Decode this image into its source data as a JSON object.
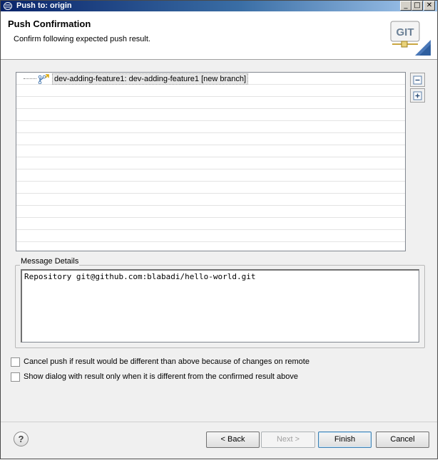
{
  "window": {
    "title": "Push to: origin",
    "controls": {
      "minimize": "_",
      "maximize": "□",
      "close": "✕"
    }
  },
  "banner": {
    "title": "Push Confirmation",
    "description": "Confirm following expected push result.",
    "logo_text": "GIT"
  },
  "tree": {
    "items": [
      {
        "label": "dev-adding-feature1: dev-adding-feature1 [new branch]",
        "icon": "push-branch-icon"
      }
    ],
    "collapse_all_icon": "collapse-all-icon",
    "expand_all_icon": "expand-all-icon"
  },
  "message_details": {
    "label": "Message Details",
    "text": "Repository git@github.com:blabadi/hello-world.git"
  },
  "options": [
    {
      "label": "Cancel push if result would be different than above because of changes on remote",
      "checked": false
    },
    {
      "label": "Show dialog with result only when it is different from the confirmed result above",
      "checked": false
    }
  ],
  "footer": {
    "help_label": "?",
    "back_label": "< Back",
    "next_label": "Next >",
    "finish_label": "Finish",
    "cancel_label": "Cancel"
  }
}
